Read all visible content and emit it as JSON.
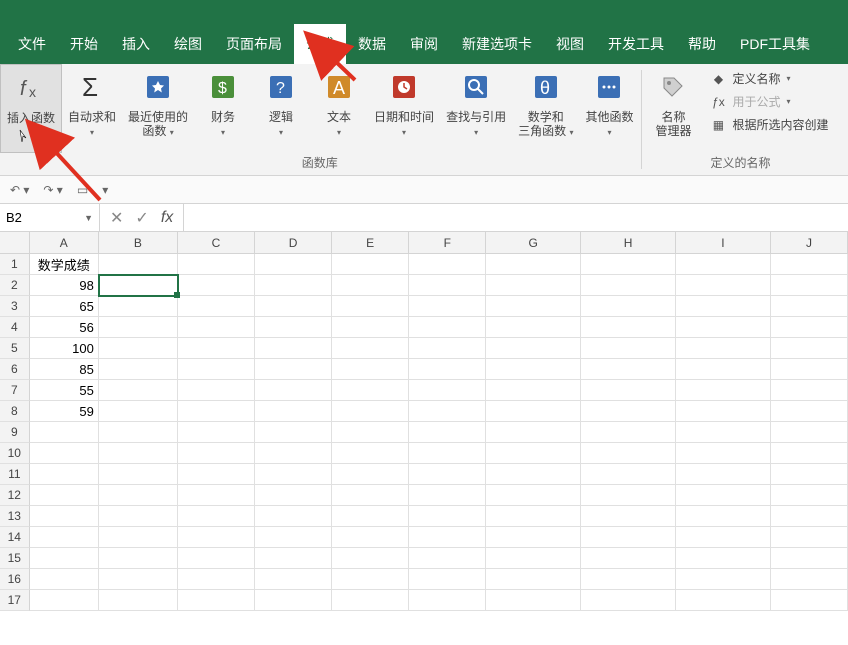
{
  "menu": {
    "tabs": [
      "文件",
      "开始",
      "插入",
      "绘图",
      "页面布局",
      "公式",
      "数据",
      "审阅",
      "新建选项卡",
      "视图",
      "开发工具",
      "帮助",
      "PDF工具集"
    ],
    "active": "公式"
  },
  "ribbon": {
    "insert_fn": "插入函数",
    "autosum": "自动求和",
    "recent": "最近使用的\n函数",
    "financial": "财务",
    "logical": "逻辑",
    "text": "文本",
    "datetime": "日期和时间",
    "lookup": "查找与引用",
    "math": "数学和\n三角函数",
    "more_fn": "其他函数",
    "group_library": "函数库",
    "name_mgr": "名称\n管理器",
    "define_name": "定义名称",
    "use_in_formula": "用于公式",
    "create_from_sel": "根据所选内容创建",
    "group_names": "定义的名称"
  },
  "formula_bar": {
    "name_box": "B2",
    "fx": "fx",
    "value": ""
  },
  "columns": [
    "A",
    "B",
    "C",
    "D",
    "E",
    "F",
    "G",
    "H",
    "I",
    "J"
  ],
  "row_count": 17,
  "active_cell": {
    "row": 2,
    "col": "B"
  },
  "cells": {
    "A1": "数学成绩",
    "A2": "98",
    "A3": "65",
    "A4": "56",
    "A5": "100",
    "A6": "85",
    "A7": "55",
    "A8": "59"
  }
}
